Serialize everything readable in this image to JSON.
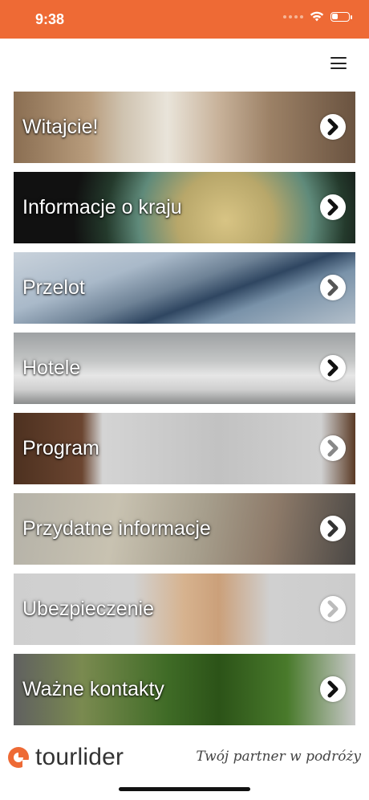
{
  "status_bar": {
    "time": "9:38",
    "battery_level": 0.3
  },
  "header": {
    "menu_icon": "hamburger-menu-icon"
  },
  "tiles": [
    {
      "label": "Witajcie!",
      "icon": "chevron-right-icon"
    },
    {
      "label": "Informacje o kraju",
      "icon": "chevron-right-icon"
    },
    {
      "label": "Przelot",
      "icon": "chevron-right-icon"
    },
    {
      "label": "Hotele",
      "icon": "chevron-right-icon"
    },
    {
      "label": "Program",
      "icon": "chevron-right-icon"
    },
    {
      "label": "Przydatne informacje",
      "icon": "chevron-right-icon"
    },
    {
      "label": "Ubezpieczenie",
      "icon": "chevron-right-icon"
    },
    {
      "label": "Ważne kontakty",
      "icon": "chevron-right-icon"
    }
  ],
  "footer": {
    "logo_text": "tourlider",
    "tagline": "Twój partner w podróży"
  },
  "colors": {
    "brand_orange": "#ee6a35",
    "text_dark": "#333333"
  }
}
